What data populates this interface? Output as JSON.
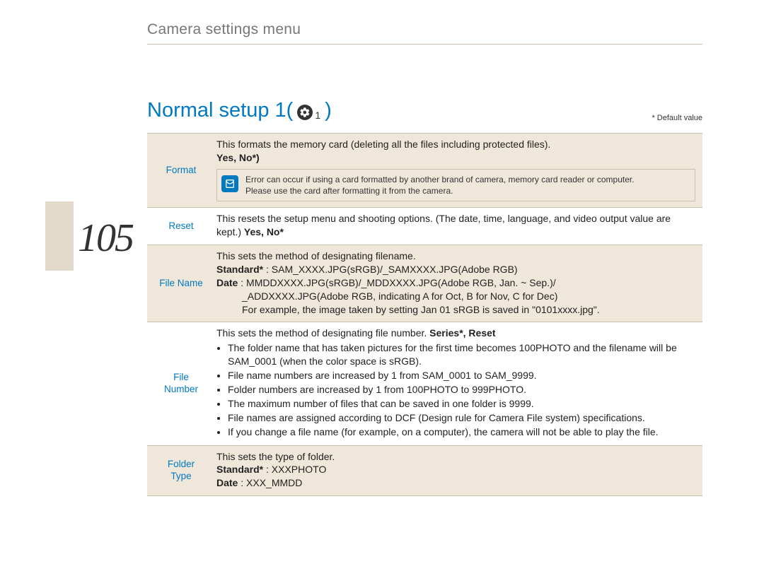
{
  "header": "Camera settings menu",
  "page_number": "105",
  "section_title_prefix": "Normal setup 1(",
  "gear_sub": "1",
  "section_title_suffix": ")",
  "default_note": "* Default value",
  "rows": {
    "format": {
      "label": "Format",
      "desc_line1": "This formats the memory card (deleting all the files including protected files).",
      "options": "Yes, No*)",
      "note_line1": "Error can occur if using a card formatted by another brand of camera, memory card reader or computer.",
      "note_line2": "Please use the card after formatting it from the camera."
    },
    "reset": {
      "label": "Reset",
      "desc": "This resets the setup menu and shooting options. (The date, time, language, and video output value are kept.) ",
      "options": "Yes, No*"
    },
    "filename": {
      "label": "File Name",
      "line1": "This sets the method of designating filename.",
      "standard_label": "Standard*",
      "standard_val": " : SAM_XXXX.JPG(sRGB)/_SAMXXXX.JPG(Adobe RGB)",
      "date_label": "Date",
      "date_val": " : MMDDXXXX.JPG(sRGB)/_MDDXXXX.JPG(Adobe RGB, Jan. ~ Sep.)/",
      "date_val2": "_ADDXXXX.JPG(Adobe RGB,  indicating A for Oct, B for Nov, C for Dec)",
      "date_val3": "For example, the image taken by setting Jan 01 sRGB is saved in \"0101xxxx.jpg\"."
    },
    "filenumber": {
      "label1": "File",
      "label2": "Number",
      "intro_pre": "This sets the method of designating file number. ",
      "intro_bold": "Series*, Reset",
      "b1": "The folder name that has taken pictures for the first time becomes 100PHOTO and the filename will be SAM_0001 (when the color space is sRGB).",
      "b2": "File name numbers are increased by 1 from SAM_0001 to SAM_9999.",
      "b3": "Folder numbers are increased by 1 from 100PHOTO to 999PHOTO.",
      "b4": "The maximum number of files that can be saved in one folder is 9999.",
      "b5": "File names are assigned according to DCF (Design rule for Camera File system) specifications.",
      "b6": "If you change a file name (for example, on a computer), the camera will not be able to play the file."
    },
    "foldertype": {
      "label1": "Folder",
      "label2": "Type",
      "line1": "This sets the type of folder.",
      "standard_label": "Standard*",
      "standard_val": " : XXXPHOTO",
      "date_label": "Date",
      "date_val": " : XXX_MMDD"
    }
  }
}
